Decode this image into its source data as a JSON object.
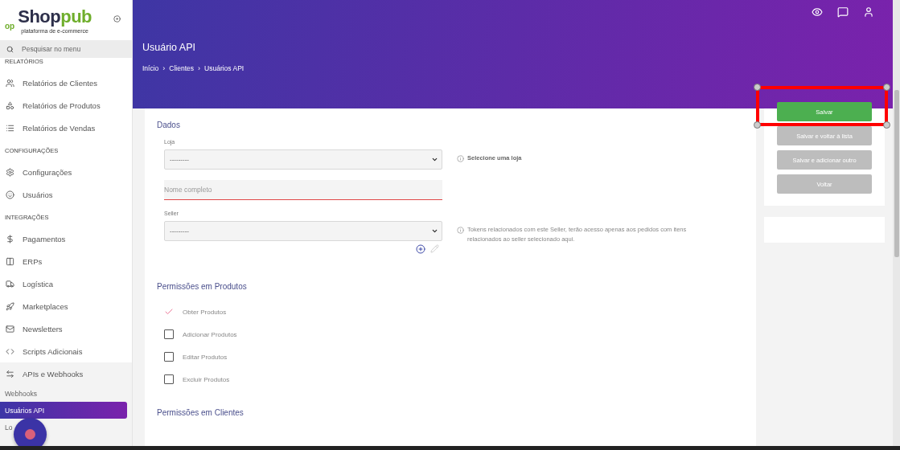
{
  "sidebar": {
    "logo": {
      "mark": "op",
      "name_dark": "Shop",
      "name_green": "pub",
      "tagline": "plataforma de e-commerce"
    },
    "search": {
      "placeholder": "Pesquisar no menu"
    },
    "sections": [
      {
        "title": "RELATÓRIOS",
        "items": [
          {
            "label": "Relatórios de Clientes"
          },
          {
            "label": "Relatórios de Produtos"
          },
          {
            "label": "Relatórios de Vendas"
          }
        ]
      },
      {
        "title": "CONFIGURAÇÕES",
        "items": [
          {
            "label": "Configurações"
          },
          {
            "label": "Usuários"
          }
        ]
      },
      {
        "title": "INTEGRAÇÕES",
        "items": [
          {
            "label": "Pagamentos"
          },
          {
            "label": "ERPs"
          },
          {
            "label": "Logística"
          },
          {
            "label": "Marketplaces"
          },
          {
            "label": "Newsletters"
          },
          {
            "label": "Scripts Adicionais"
          },
          {
            "label": "APIs e Webhooks",
            "children": [
              {
                "label": "Webhooks",
                "selected": false
              },
              {
                "label": "Usuários API",
                "selected": true
              },
              {
                "label": "Lo",
                "selected": false
              }
            ]
          }
        ]
      }
    ]
  },
  "header": {
    "title": "Usuário API",
    "breadcrumb": [
      {
        "label": "Início"
      },
      {
        "separator": "›",
        "label": "Clientes"
      },
      {
        "separator": "›",
        "label": "Usuários API"
      }
    ]
  },
  "form": {
    "title": "Dados",
    "fields": [
      {
        "kind": "select",
        "label": "Loja",
        "value": "---------",
        "hint": "Selecione uma loja",
        "strong": true
      },
      {
        "kind": "text",
        "placeholder": "Nome completo",
        "error": true
      },
      {
        "kind": "select",
        "label": "Seller",
        "value": "---------",
        "hint": "Tokens relacionados com este Seller, terão acesso apenas aos pedidos com itens relacionados ao seller selecionado aqui.",
        "strong": false,
        "tools": true
      }
    ]
  },
  "permissions": [
    {
      "title": "Permissões em Produtos",
      "items": [
        {
          "label": "Obter Produtos",
          "checked": true
        },
        {
          "label": "Adicionar Produtos",
          "checked": false
        },
        {
          "label": "Editar Produtos",
          "checked": false
        },
        {
          "label": "Excluir Produtos",
          "checked": false
        }
      ]
    },
    {
      "title": "Permissões em Clientes"
    }
  ],
  "actions": [
    {
      "label": "Salvar",
      "kind": "primary",
      "highlighted": true
    },
    {
      "label": "Salvar e voltar à lista",
      "kind": "secondary",
      "highlighted": false
    },
    {
      "label": "Salvar e adicionar outro",
      "kind": "secondary",
      "highlighted": false
    },
    {
      "label": "Voltar",
      "kind": "secondary",
      "highlighted": false
    }
  ]
}
